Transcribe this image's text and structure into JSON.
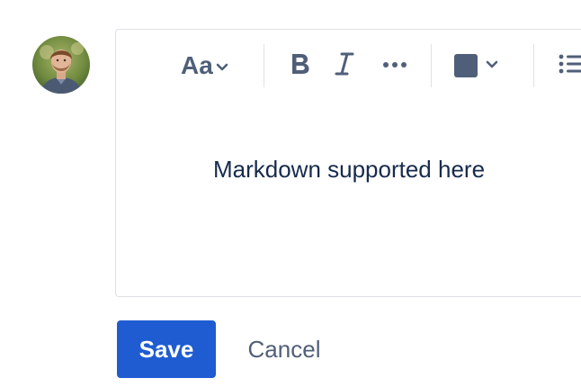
{
  "editor": {
    "placeholder": "Markdown supported here"
  },
  "toolbar": {
    "text_style_label": "Aa",
    "text_style_icon": "chevron-down-icon",
    "bold_icon": "bold-icon",
    "italic_icon": "italic-icon",
    "more_icon": "more-horizontal-icon",
    "color_icon": "text-color-icon",
    "color_value": "#505f79",
    "list_icon": "bullet-list-icon"
  },
  "actions": {
    "save_label": "Save",
    "cancel_label": "Cancel"
  },
  "colors": {
    "primary": "#1f5cd1",
    "border": "#dfe1e6",
    "icon": "#505f79",
    "text": "#172b4d"
  }
}
